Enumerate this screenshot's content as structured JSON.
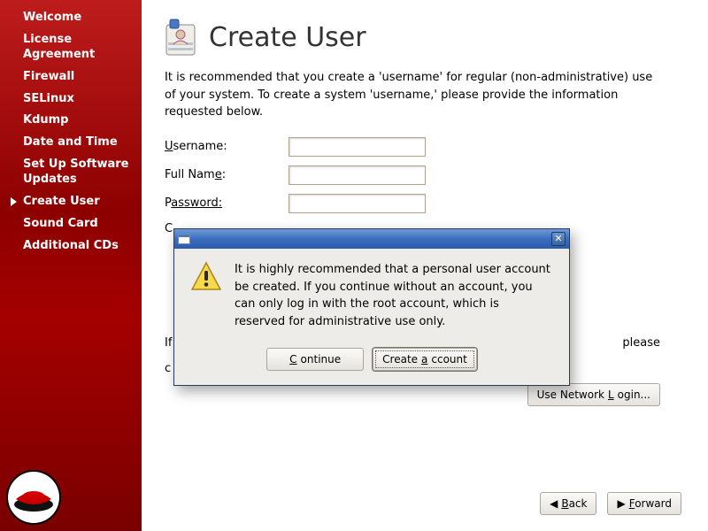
{
  "sidebar": {
    "items": [
      {
        "label": "Welcome"
      },
      {
        "label": "License Agreement"
      },
      {
        "label": "Firewall"
      },
      {
        "label": "SELinux"
      },
      {
        "label": "Kdump"
      },
      {
        "label": "Date and Time"
      },
      {
        "label": "Set Up Software Updates"
      },
      {
        "label": "Create User"
      },
      {
        "label": "Sound Card"
      },
      {
        "label": "Additional CDs"
      }
    ],
    "active_index": 7
  },
  "page": {
    "title": "Create User",
    "intro": "It is recommended that you create a 'username' for regular (non-administrative) use of your system. To create a system 'username,' please provide the information requested below."
  },
  "form": {
    "username_label_pre": "U",
    "username_label_rest": "sername:",
    "username_value": "",
    "fullname_label_pre": "Full Nam",
    "fullname_label_ul": "e",
    "fullname_label_post": ":",
    "fullname_value": "",
    "password_label_pre": "P",
    "password_label_rest": "assword:",
    "password_value": "",
    "confirm_label_left": "C",
    "note_left": "If",
    "note_right_tail": "please",
    "note_left2": "c",
    "network_login_pre": "Use Network ",
    "network_login_ul": "L",
    "network_login_post": "ogin..."
  },
  "dialog": {
    "text": "It is highly recommended that a personal user account be created.  If you continue without an account, you can only log in with the root account, which is reserved for administrative use only.",
    "continue_ul": "C",
    "continue_rest": "ontinue",
    "create_pre": "Create ",
    "create_ul": "a",
    "create_post": "ccount"
  },
  "footer": {
    "back_ul": "B",
    "back_rest": "ack",
    "forward_ul": "F",
    "forward_rest": "orward"
  }
}
